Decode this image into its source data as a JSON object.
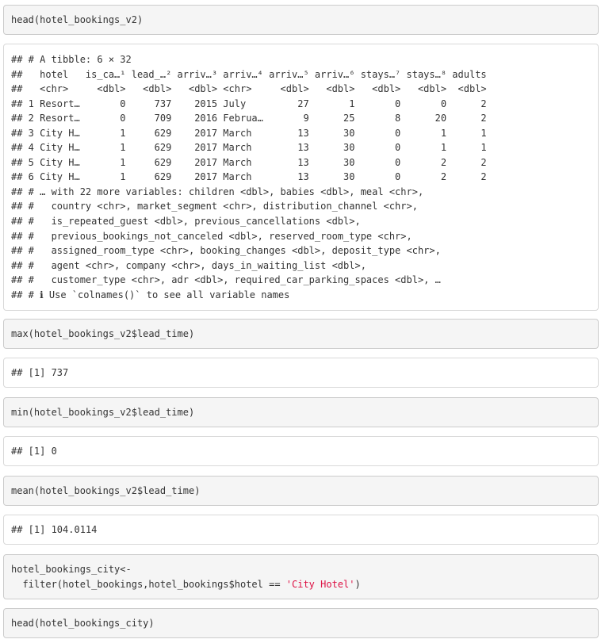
{
  "cells": [
    {
      "kind": "code",
      "lines": [
        "head(hotel_bookings_v2)"
      ]
    },
    {
      "kind": "output",
      "lines": [
        "## # A tibble: 6 × 32",
        "##   hotel   is_ca…¹ lead_…² arriv…³ arriv…⁴ arriv…⁵ arriv…⁶ stays…⁷ stays…⁸ adults",
        "##   <chr>     <dbl>   <dbl>   <dbl> <chr>     <dbl>   <dbl>   <dbl>   <dbl>  <dbl>",
        "## 1 Resort…       0     737    2015 July         27       1       0       0      2",
        "## 2 Resort…       0     709    2016 Februa…       9      25       8      20      2",
        "## 3 City H…       1     629    2017 March        13      30       0       1      1",
        "## 4 City H…       1     629    2017 March        13      30       0       1      1",
        "## 5 City H…       1     629    2017 March        13      30       0       2      2",
        "## 6 City H…       1     629    2017 March        13      30       0       2      2",
        "## # … with 22 more variables: children <dbl>, babies <dbl>, meal <chr>,",
        "## #   country <chr>, market_segment <chr>, distribution_channel <chr>,",
        "## #   is_repeated_guest <dbl>, previous_cancellations <dbl>,",
        "## #   previous_bookings_not_canceled <dbl>, reserved_room_type <chr>,",
        "## #   assigned_room_type <chr>, booking_changes <dbl>, deposit_type <chr>,",
        "## #   agent <chr>, company <chr>, days_in_waiting_list <dbl>,",
        "## #   customer_type <chr>, adr <dbl>, required_car_parking_spaces <dbl>, …",
        "## # ℹ Use `colnames()` to see all variable names"
      ]
    },
    {
      "kind": "code",
      "lines": [
        "max(hotel_bookings_v2$lead_time)"
      ]
    },
    {
      "kind": "output",
      "lines": [
        "## [1] 737"
      ]
    },
    {
      "kind": "code",
      "lines": [
        "min(hotel_bookings_v2$lead_time)"
      ]
    },
    {
      "kind": "output",
      "lines": [
        "## [1] 0"
      ]
    },
    {
      "kind": "code",
      "lines": [
        "mean(hotel_bookings_v2$lead_time)"
      ]
    },
    {
      "kind": "output",
      "lines": [
        "## [1] 104.0114"
      ]
    },
    {
      "kind": "code",
      "lines": [
        "hotel_bookings_city<-",
        "  filter(hotel_bookings,hotel_bookings$hotel == "
      ],
      "string_literal": "'City Hotel'",
      "closing": ")"
    },
    {
      "kind": "code",
      "lines": [
        "head(hotel_bookings_city)"
      ]
    }
  ]
}
